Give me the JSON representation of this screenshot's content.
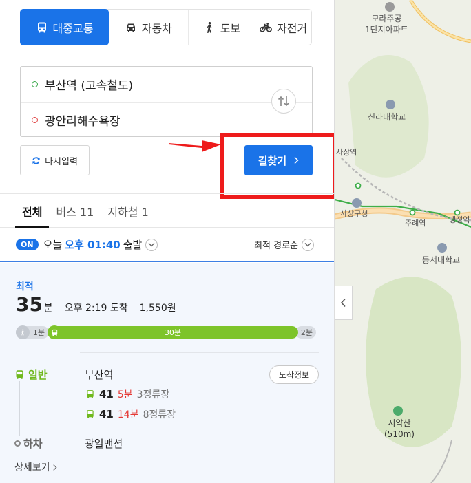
{
  "modes": [
    {
      "label": "대중교통",
      "icon": "bus-icon"
    },
    {
      "label": "자동차",
      "icon": "car-icon"
    },
    {
      "label": "도보",
      "icon": "walk-icon"
    },
    {
      "label": "자전거",
      "icon": "bicycle-icon"
    }
  ],
  "route": {
    "origin": "부산역 (고속철도)",
    "destination": "광안리해수욕장"
  },
  "actions": {
    "reset": "다시입력",
    "search": "길찾기"
  },
  "tabs": [
    {
      "label": "전체"
    },
    {
      "label": "버스 11"
    },
    {
      "label": "지하철 1"
    }
  ],
  "departure": {
    "badge": "ON",
    "day": "오늘",
    "time": "오후 01:40",
    "suffix": "출발",
    "sort": "최적 경로순"
  },
  "result": {
    "label": "최적",
    "duration": "35",
    "duration_unit": "분",
    "arrival": "오후 2:19 도착",
    "fare": "1,550원",
    "segments": {
      "walk_start": "1분",
      "bus": "30분",
      "walk_end": "2분"
    },
    "steps": {
      "board_type": "일반",
      "board_stop": "부산역",
      "arrival_info": "도착정보",
      "buses": [
        {
          "number": "41",
          "eta": "5분",
          "stops": "3정류장"
        },
        {
          "number": "41",
          "eta": "14분",
          "stops": "8정류장"
        }
      ],
      "alight_label": "하차",
      "alight_stop": "광일맨션"
    },
    "detail": "상세보기"
  },
  "map": {
    "labels": [
      "모라주공\n1단지아파트",
      "신라대학교",
      "사상역",
      "사상구청",
      "주례역",
      "냉정역",
      "동서대학교",
      "시약산\n(510m)"
    ]
  },
  "colors": {
    "primary": "#1a73e8",
    "bus_green": "#7dc42a",
    "highlight": "#ee1b1b"
  }
}
